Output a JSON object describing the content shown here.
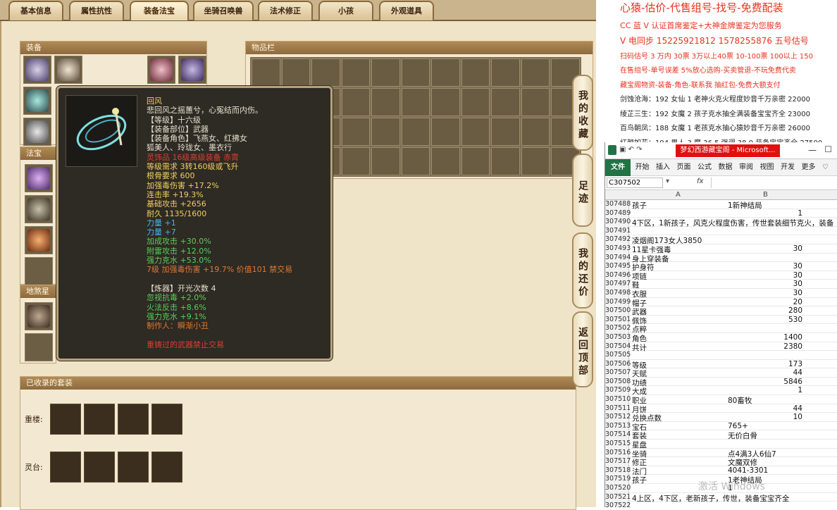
{
  "tabs": [
    "基本信息",
    "属性抗性",
    "装备法宝",
    "坐骑召唤兽",
    "法术修正",
    "小孩",
    "外观道具"
  ],
  "active_tab": "装备法宝",
  "sections": {
    "equip": "装备",
    "items": "物品栏",
    "fabao": "法宝",
    "diquan": "地煞星阵",
    "suits": "已收录的套装"
  },
  "side_buttons": [
    "我的收藏",
    "足迹",
    "我的还价",
    "返回顶部"
  ],
  "suit_rows": [
    {
      "label": "重楼:"
    },
    {
      "label": "灵台:"
    }
  ],
  "tooltip": {
    "name": "回风",
    "lines": [
      {
        "t": "悲回风之摇蕙兮，心冤结而内伤。",
        "c": "#e6e0cc"
      },
      {
        "t": "【等级】十六级",
        "c": "#e6e0cc"
      },
      {
        "t": "【装备部位】武器",
        "c": "#e6e0cc"
      },
      {
        "t": "【装备角色】飞燕女、红拂女",
        "c": "#e6e0cc"
      },
      {
        "t": "狐美人、玲珑女、墨衣行",
        "c": "#e6e0cc"
      },
      {
        "t": "灵饰品 16级高级装备 赤霄",
        "c": "#d9402e"
      },
      {
        "t": "等级需求 3转160级或飞升",
        "c": "#f0d060"
      },
      {
        "t": "根骨要求 600",
        "c": "#f0d060"
      },
      {
        "t": "加强毒伤害 +17.2%",
        "c": "#f0d060"
      },
      {
        "t": "连击率 +19.3%",
        "c": "#f0d060"
      },
      {
        "t": "基础攻击 +2656",
        "c": "#f0d060"
      },
      {
        "t": "耐久 1135/1600",
        "c": "#f0d060"
      },
      {
        "t": "力量 +1",
        "c": "#49b4e8"
      },
      {
        "t": "力量 +7",
        "c": "#49b4e8"
      },
      {
        "t": "加成攻击 +30.0%",
        "c": "#58d058"
      },
      {
        "t": "附雷攻击 +12.0%",
        "c": "#58d058"
      },
      {
        "t": "强力克水 +53.0%",
        "c": "#58d058"
      },
      {
        "t": "7级 加强毒伤害 +19.7% 价值101 禁交易",
        "c": "#e07830"
      },
      {
        "t": "",
        "c": "#e6e0cc"
      },
      {
        "t": "【炼器】开光次数 4",
        "c": "#e6e0cc"
      },
      {
        "t": "忽视抗毒 +2.0%",
        "c": "#58d058"
      },
      {
        "t": "火法反击 +8.6%",
        "c": "#58d058"
      },
      {
        "t": "强力克水 +9.1%",
        "c": "#58d058"
      },
      {
        "t": "制作人：瞬渐小丑",
        "c": "#e07830"
      },
      {
        "t": "",
        "c": "#e6e0cc"
      },
      {
        "t": "重铸过的武器禁止交易",
        "c": "#d9402e"
      }
    ]
  },
  "promo": [
    {
      "t": "心猿-估价-代售组号-找号-免费配装",
      "c": "#e8321e",
      "s": 15
    },
    {
      "t": "CC 蓝 V 认证首席鉴定+大神金牌鉴定为您服务",
      "c": "#e8321e",
      "s": 11
    },
    {
      "t": "V 电同步 15225921812 1578255876 五号估号",
      "c": "#e8321e",
      "s": 12
    },
    {
      "t": "扫码估号 3 万内 30票 3万以上40票 10-100票 100以上 150",
      "c": "#e8321e",
      "s": 10
    },
    {
      "t": "在售组号-单号误差 5%放心选购-买卖管退-不玩免费代卖",
      "c": "#e8321e",
      "s": 10
    },
    {
      "t": "藏宝阁物资-装备-角色-联系我 抽红包-免费大额支付",
      "c": "#e8321e",
      "s": 10
    },
    {
      "t": "剑蚀沧海：192 女仙 1 老神火克火程度妙音千万亲密 22000",
      "c": "#222",
      "s": 10
    },
    {
      "t": "绫芷三生：192 女魔 2 孩子克水抽全满装备宝宝齐全 23000",
      "c": "#222",
      "s": 10
    },
    {
      "t": "百鸟朝凤：188 女魔 1 老孩克水抽心猿妙音千万亲密 26000",
      "c": "#222",
      "s": 10
    },
    {
      "t": "红颜如花：194 男人 3 魔 36.5 强调 38.9 装备宝宝齐全 27500",
      "c": "#222",
      "s": 10
    }
  ],
  "excel": {
    "taskbar_tab": "梦幻西游藏宝阁 - Microsoft...",
    "ribbon": [
      "文件",
      "开始",
      "插入",
      "页面",
      "公式",
      "数据",
      "审阅",
      "视图",
      "开发",
      "更多"
    ],
    "name_box": "C307502",
    "fx": "fx",
    "col_a": "A",
    "col_b": "B",
    "rows": [
      {
        "n": "307488",
        "a": "孩子",
        "b": "1新神结局",
        "bn": ""
      },
      {
        "n": "307489",
        "a": "",
        "b": "",
        "bn": "1"
      },
      {
        "n": "307490",
        "a": "4下区，1新孩子，风克火程度伤害，传世套装细节克火，装备",
        "b": "",
        "bn": ""
      },
      {
        "n": "307491",
        "a": "",
        "b": "",
        "bn": ""
      },
      {
        "n": "307492",
        "a": "凌烟阁173女人3850",
        "b": "",
        "bn": ""
      },
      {
        "n": "307493",
        "a": "11星卡强毒",
        "b": "",
        "bn": "30"
      },
      {
        "n": "307494",
        "a": "身上穿装备",
        "b": "",
        "bn": ""
      },
      {
        "n": "307495",
        "a": "护身符",
        "b": "",
        "bn": "30"
      },
      {
        "n": "307496",
        "a": "项链",
        "b": "",
        "bn": "30"
      },
      {
        "n": "307497",
        "a": "鞋",
        "b": "",
        "bn": "30"
      },
      {
        "n": "307498",
        "a": "衣服",
        "b": "",
        "bn": "30"
      },
      {
        "n": "307499",
        "a": "帽子",
        "b": "",
        "bn": "20"
      },
      {
        "n": "307500",
        "a": "武器",
        "b": "",
        "bn": "280"
      },
      {
        "n": "307501",
        "a": "佩饰",
        "b": "",
        "bn": "530"
      },
      {
        "n": "307502",
        "a": "点粹",
        "b": "",
        "bn": ""
      },
      {
        "n": "307503",
        "a": "角色",
        "b": "",
        "bn": "1400"
      },
      {
        "n": "307504",
        "a": "共计",
        "b": "",
        "bn": "2380"
      },
      {
        "n": "307505",
        "a": "",
        "b": "",
        "bn": ""
      },
      {
        "n": "307506",
        "a": "等级",
        "b": "",
        "bn": "173"
      },
      {
        "n": "307507",
        "a": "天赋",
        "b": "",
        "bn": "44"
      },
      {
        "n": "307508",
        "a": "功绩",
        "b": "",
        "bn": "5846"
      },
      {
        "n": "307509",
        "a": "大成",
        "b": "",
        "bn": "1"
      },
      {
        "n": "307510",
        "a": "职业",
        "b": "80畜牧",
        "bn": ""
      },
      {
        "n": "307511",
        "a": "月饼",
        "b": "",
        "bn": "44"
      },
      {
        "n": "307512",
        "a": "兑换点数",
        "b": "",
        "bn": "10"
      },
      {
        "n": "307513",
        "a": "宝石",
        "b": "765+",
        "bn": ""
      },
      {
        "n": "307514",
        "a": "套装",
        "b": "无价白骨",
        "bn": ""
      },
      {
        "n": "307515",
        "a": "星盘",
        "b": "",
        "bn": ""
      },
      {
        "n": "307516",
        "a": "坐骑",
        "b": "点4满3人6仙7",
        "bn": ""
      },
      {
        "n": "307517",
        "a": "修正",
        "b": "文魔双修",
        "bn": ""
      },
      {
        "n": "307518",
        "a": "法门",
        "b": "4041-3301",
        "bn": ""
      },
      {
        "n": "307519",
        "a": "孩子",
        "b": "1老神结局",
        "bn": ""
      },
      {
        "n": "307520",
        "a": "",
        "b": "1",
        "bn": ""
      },
      {
        "n": "307521",
        "a": "4上区，4下区，老新孩子，传世，装备宝宝齐全",
        "b": "",
        "bn": ""
      },
      {
        "n": "307522",
        "a": "",
        "b": "",
        "bn": ""
      }
    ],
    "watermark": "激活 Windows"
  }
}
